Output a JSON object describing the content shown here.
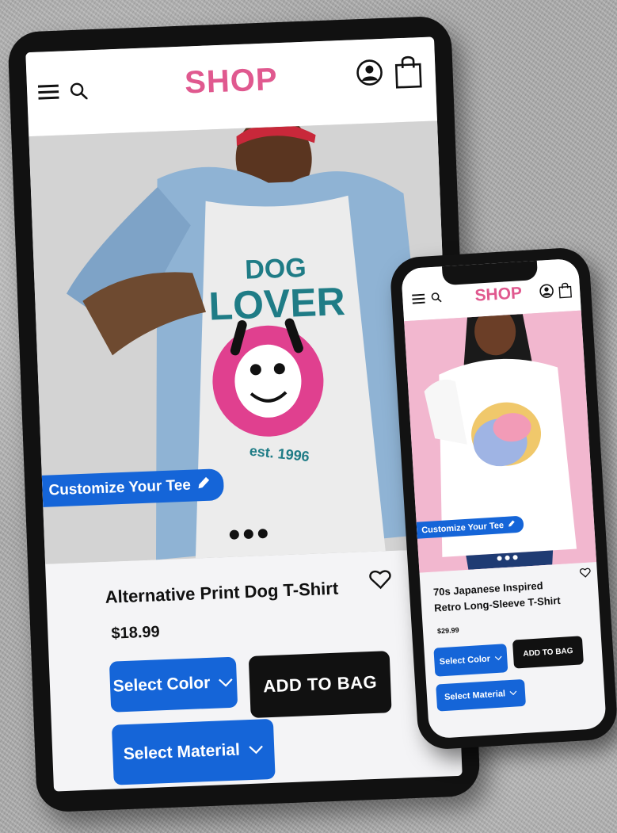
{
  "tablet": {
    "header": {
      "logo": "SHOP",
      "menu_icon": "hamburger-menu-icon",
      "search_icon": "search-icon",
      "account_icon": "user-account-icon",
      "bag_icon": "shopping-bag-icon"
    },
    "hero": {
      "shirt_text_line1": "DOG",
      "shirt_text_line2": "LOVER",
      "shirt_text_line3": "est. 1996",
      "customize_label": "Customize Your Tee",
      "carousel_pages": 3
    },
    "product": {
      "title": "Alternative Print Dog T-Shirt",
      "price": "$18.99",
      "select_color_label": "Select Color",
      "add_to_bag_label": "ADD TO BAG",
      "select_material_label": "Select Material"
    }
  },
  "phone": {
    "header": {
      "logo": "SHOP",
      "menu_icon": "hamburger-menu-icon",
      "search_icon": "search-icon",
      "account_icon": "user-account-icon",
      "bag_icon": "shopping-bag-icon"
    },
    "hero": {
      "customize_label": "Customize Your Tee",
      "carousel_pages": 3
    },
    "product": {
      "title_line1": "70s Japanese Inspired",
      "title_line2": "Retro Long-Sleeve T-Shirt",
      "price": "$29.99",
      "select_color_label": "Select Color",
      "add_to_bag_label": "ADD TO BAG",
      "select_material_label": "Select Material"
    }
  },
  "colors": {
    "brand_pink": "#e0598f",
    "action_blue": "#1565d8",
    "action_black": "#111111"
  }
}
